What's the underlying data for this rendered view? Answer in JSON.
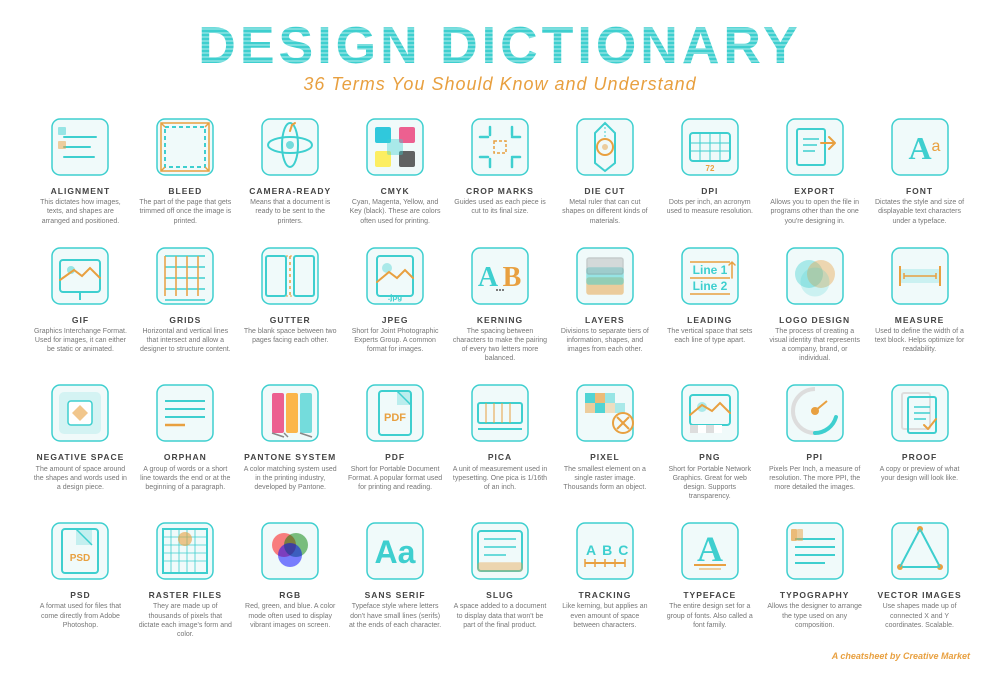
{
  "header": {
    "title": "DESIGN DICTIONARY",
    "subtitle": "36 Terms You Should Know and Understand"
  },
  "footer": {
    "text": "A cheatsheet by",
    "brand": "Creative Market"
  },
  "terms": [
    {
      "name": "ALIGNMENT",
      "desc": "This dictates how images, texts, and shapes are arranged and positioned."
    },
    {
      "name": "BLEED",
      "desc": "The part of the page that gets trimmed off once the image is printed."
    },
    {
      "name": "CAMERA-READY",
      "desc": "Means that a document is ready to be sent to the printers."
    },
    {
      "name": "CMYK",
      "desc": "Cyan, Magenta, Yellow, and Key (black). These are colors often used for printing."
    },
    {
      "name": "CROP MARKS",
      "desc": "Guides used as each piece is cut to its final size."
    },
    {
      "name": "DIE CUT",
      "desc": "Metal ruler that can cut shapes on different kinds of materials."
    },
    {
      "name": "DPI",
      "desc": "Dots per inch, an acronym used to measure resolution."
    },
    {
      "name": "EXPORT",
      "desc": "Allows you to open the file in programs other than the one you're designing in."
    },
    {
      "name": "FONT",
      "desc": "Dictates the style and size of displayable text characters under a typeface."
    },
    {
      "name": "GIF",
      "desc": "Graphics Interchange Format. Used for images, it can either be static or animated."
    },
    {
      "name": "GRIDS",
      "desc": "Horizontal and vertical lines that intersect and allow a designer to structure content."
    },
    {
      "name": "GUTTER",
      "desc": "The blank space between two pages facing each other."
    },
    {
      "name": "JPEG",
      "desc": "Short for Joint Photographic Experts Group. A common format for images."
    },
    {
      "name": "KERNING",
      "desc": "The spacing between characters to make the pairing of every two letters more balanced."
    },
    {
      "name": "LAYERS",
      "desc": "Divisions to separate tiers of information, shapes, and images from each other."
    },
    {
      "name": "LEADING",
      "desc": "The vertical space that sets each line of type apart."
    },
    {
      "name": "LOGO DESIGN",
      "desc": "The process of creating a visual identity that represents a company, brand, or individual."
    },
    {
      "name": "MEASURE",
      "desc": "Used to define the width of a text block. Helps optimize for readability."
    },
    {
      "name": "NEGATIVE SPACE",
      "desc": "The amount of space around the shapes and words used in a design piece."
    },
    {
      "name": "ORPHAN",
      "desc": "A group of words or a short line towards the end or at the beginning of a paragraph."
    },
    {
      "name": "PANTONE SYSTEM",
      "desc": "A color matching system used in the printing industry, developed by Pantone."
    },
    {
      "name": "PDF",
      "desc": "Short for Portable Document Format. A popular format used for printing and reading."
    },
    {
      "name": "PICA",
      "desc": "A unit of measurement used in typesetting. One pica is 1/16th of an inch."
    },
    {
      "name": "PIXEL",
      "desc": "The smallest element on a single raster image. Thousands form an object."
    },
    {
      "name": "PNG",
      "desc": "Short for Portable Network Graphics. Great for web design. Supports transparency."
    },
    {
      "name": "PPI",
      "desc": "Pixels Per Inch, a measure of resolution. The more PPI, the more detailed the images."
    },
    {
      "name": "PROOF",
      "desc": "A copy or preview of what your design will look like."
    },
    {
      "name": "PSD",
      "desc": "A format used for files that come directly from Adobe Photoshop."
    },
    {
      "name": "RASTER FILES",
      "desc": "They are made up of thousands of pixels that dictate each image's form and color."
    },
    {
      "name": "RGB",
      "desc": "Red, green, and blue. A color mode often used to display vibrant images on screen."
    },
    {
      "name": "SANS SERIF",
      "desc": "Typeface style where letters don't have small lines (serifs) at the ends of each character."
    },
    {
      "name": "SLUG",
      "desc": "A space added to a document to display data that won't be part of the final product."
    },
    {
      "name": "TRACKING",
      "desc": "Like kerning, but applies an even amount of space between characters."
    },
    {
      "name": "TYPEFACE",
      "desc": "The entire design set for a group of fonts. Also called a font family."
    },
    {
      "name": "TYPOGRAPHY",
      "desc": "Allows the designer to arrange the type used on any composition."
    },
    {
      "name": "VECTOR IMAGES",
      "desc": "Use shapes made up of connected X and Y coordinates. Scalable."
    }
  ]
}
